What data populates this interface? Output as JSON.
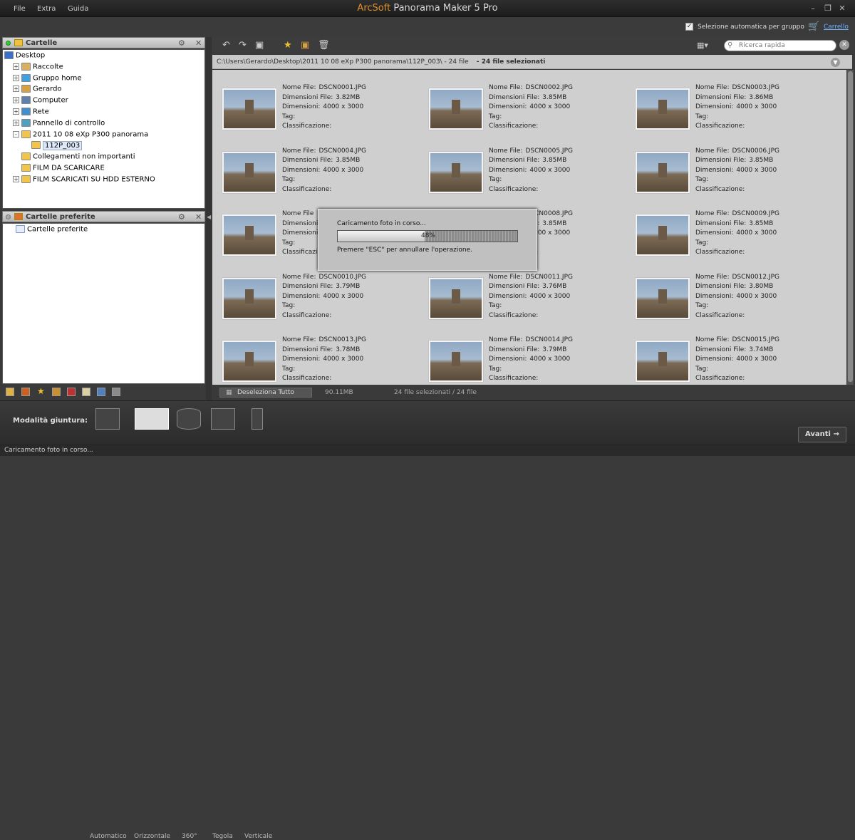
{
  "menu": [
    "File",
    "Extra",
    "Guida"
  ],
  "app": {
    "brand": "ArcSoft",
    "title": "Panorama Maker 5 Pro"
  },
  "topbar": {
    "auto_select_label": "Selezione automatica per gruppo",
    "auto_select_checked": true,
    "cart_label": "Carrello"
  },
  "folders_panel": {
    "title": "Cartelle",
    "items": [
      {
        "label": "Desktop",
        "level": 0,
        "expander": "",
        "icon": "desktop-icon"
      },
      {
        "label": "Raccolte",
        "level": 1,
        "expander": "+",
        "icon": "libraries-icon"
      },
      {
        "label": "Gruppo home",
        "level": 1,
        "expander": "+",
        "icon": "homegroup-icon"
      },
      {
        "label": "Gerardo",
        "level": 1,
        "expander": "+",
        "icon": "user-folder-icon"
      },
      {
        "label": "Computer",
        "level": 1,
        "expander": "+",
        "icon": "computer-icon"
      },
      {
        "label": "Rete",
        "level": 1,
        "expander": "+",
        "icon": "network-icon"
      },
      {
        "label": "Pannello di controllo",
        "level": 1,
        "expander": "+",
        "icon": "control-panel-icon"
      },
      {
        "label": "2011 10 08 eXp P300 panorama",
        "level": 1,
        "expander": "-",
        "icon": "folder-icon"
      },
      {
        "label": "112P_003",
        "level": 2,
        "expander": "",
        "icon": "folder-icon",
        "selected": true
      },
      {
        "label": "Collegamenti non importanti",
        "level": 1,
        "expander": "",
        "icon": "folder-icon"
      },
      {
        "label": "FILM DA SCARICARE",
        "level": 1,
        "expander": "",
        "icon": "folder-icon"
      },
      {
        "label": "FILM SCARICATI SU HDD ESTERNO",
        "level": 1,
        "expander": "+",
        "icon": "folder-icon"
      }
    ]
  },
  "favorites_panel": {
    "title": "Cartelle preferite",
    "items": [
      {
        "label": "Cartelle preferite"
      }
    ]
  },
  "search": {
    "placeholder": "Ricerca rapida"
  },
  "path": {
    "text": "C:\\Users\\Gerardo\\Desktop\\2011 10 08 eXp P300 panorama\\112P_003\\ - 24 file",
    "selected": "24 file selezionati"
  },
  "field_labels": {
    "name": "Nome File:",
    "size": "Dimensioni File:",
    "dims": "Dimensioni:",
    "tag": "Tag:",
    "rating": "Classificazione:"
  },
  "files": [
    {
      "name": "DSCN0001.JPG",
      "size": "3.82MB",
      "dims": "4000 x 3000"
    },
    {
      "name": "DSCN0002.JPG",
      "size": "3.85MB",
      "dims": "4000 x 3000"
    },
    {
      "name": "DSCN0003.JPG",
      "size": "3.86MB",
      "dims": "4000 x 3000"
    },
    {
      "name": "DSCN0004.JPG",
      "size": "3.85MB",
      "dims": "4000 x 3000"
    },
    {
      "name": "DSCN0005.JPG",
      "size": "3.85MB",
      "dims": "4000 x 3000"
    },
    {
      "name": "DSCN0006.JPG",
      "size": "3.85MB",
      "dims": "4000 x 3000"
    },
    {
      "name": "",
      "size": "",
      "dims": "",
      "label_name": "Nome File",
      "label_size": "Dimensioni F",
      "label_dims": "Dimensioni:"
    },
    {
      "name": "DSCN0008.JPG",
      "size": "3.85MB",
      "dims": "4000 x 3000"
    },
    {
      "name": "DSCN0009.JPG",
      "size": "3.85MB",
      "dims": "4000 x 3000"
    },
    {
      "name": "DSCN0010.JPG",
      "size": "3.79MB",
      "dims": "4000 x 3000"
    },
    {
      "name": "DSCN0011.JPG",
      "size": "3.76MB",
      "dims": "4000 x 3000"
    },
    {
      "name": "DSCN0012.JPG",
      "size": "3.80MB",
      "dims": "4000 x 3000"
    },
    {
      "name": "DSCN0013.JPG",
      "size": "3.78MB",
      "dims": "4000 x 3000"
    },
    {
      "name": "DSCN0014.JPG",
      "size": "3.79MB",
      "dims": "4000 x 3000"
    },
    {
      "name": "DSCN0015.JPG",
      "size": "3.74MB",
      "dims": "4000 x 3000"
    }
  ],
  "dialog": {
    "message": "Caricamento foto in corso...",
    "progress_percent": 48,
    "progress_label": "48%",
    "esc_hint": "Premere \"ESC\" per annullare l'operazione."
  },
  "footer_row": {
    "deselect_label": "Deseleziona Tutto",
    "total_size": "90.11MB",
    "count": "24 file selezionati / 24 file"
  },
  "stitch": {
    "label": "Modalità giuntura:",
    "modes": [
      {
        "label": "Automatico",
        "selected": false
      },
      {
        "label": "Orizzontale",
        "selected": true
      },
      {
        "label": "360°",
        "selected": false
      },
      {
        "label": "Tegola",
        "selected": false
      },
      {
        "label": "Verticale",
        "selected": false
      }
    ],
    "next_label": "Avanti"
  },
  "status": {
    "text": "Caricamento foto in corso..."
  },
  "colors": {
    "accent": "#e0902a",
    "link": "#6fb0ff"
  }
}
